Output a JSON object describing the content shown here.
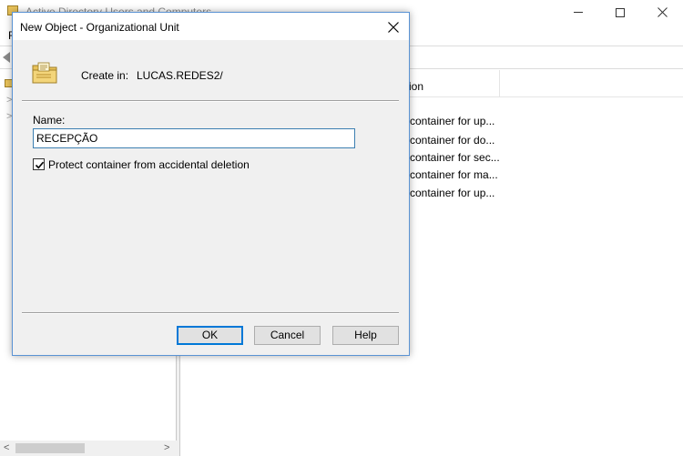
{
  "background_window": {
    "title": "Active Directory Users and Computers",
    "menu_first": "F",
    "column_header": "ion",
    "descriptions": [
      "container for up...",
      "container for do...",
      "container for sec...",
      "container for ma...",
      "container for up..."
    ]
  },
  "dialog": {
    "title": "New Object - Organizational Unit",
    "close_glyph": "✕",
    "create_in_label": "Create in:",
    "create_in_value": "LUCAS.REDES2/",
    "name_label": "Name:",
    "name_value": "RECEPÇÃO",
    "protect_label": "Protect container from accidental deletion",
    "protect_checked": true,
    "buttons": {
      "ok": "OK",
      "cancel": "Cancel",
      "help": "Help"
    }
  },
  "colors": {
    "dialog_border": "#5a93d4",
    "default_button_border": "#0078d7",
    "input_border": "#3c7fb1",
    "folder_yellow": "#e8c25a"
  },
  "icons": {
    "ou_icon": "organizational-unit-icon",
    "close": "close-icon",
    "check": "check-icon"
  }
}
